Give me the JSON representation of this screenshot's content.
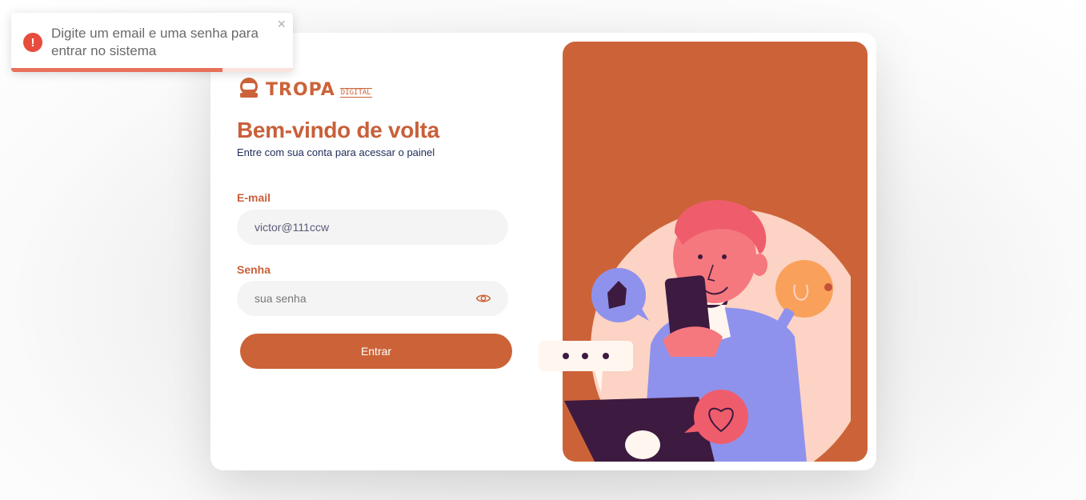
{
  "toast": {
    "message": "Digite um email e uma senha para entrar no sistema",
    "close": "×",
    "icon": "error-icon",
    "progress": 0.75,
    "color": "#e74c3c"
  },
  "brand": {
    "logo_main": "TROPA",
    "logo_sub": "DIGITAL",
    "accent": "#cc6338"
  },
  "login": {
    "title": "Bem-vindo de volta",
    "subtitle": "Entre com sua conta para acessar o painel",
    "email_label": "E-mail",
    "email_value": "victor@111ccw",
    "password_label": "Senha",
    "password_placeholder": "sua senha",
    "submit": "Entrar"
  }
}
